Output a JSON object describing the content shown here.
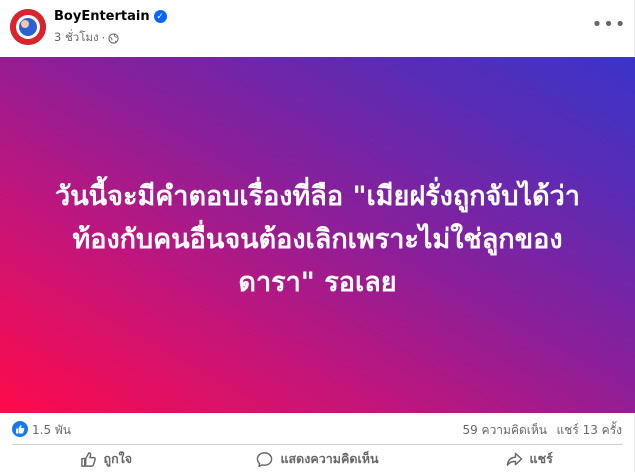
{
  "post": {
    "author": "BoyEntertain",
    "time": "3 ชั่วโมง",
    "image_text": "วันนี้จะมีคำตอบเรื่องที่ลือ \"เมียฝรั่งถูกจับได้ว่า\nท้องกับคนอื่นจนต้องเลิกเพราะไม่ใช่ลูกของ\nดารา\" รอเลย"
  },
  "stats": {
    "reactions": "1.5 พัน",
    "comments": "59 ความคิดเห็น",
    "shares": "แชร์ 13 ครั้ง"
  },
  "actions": {
    "like": "ถูกใจ",
    "comment": "แสดงความคิดเห็น",
    "share": "แชร์"
  },
  "colors": {
    "accent": "#1877f2",
    "gradient_start": "#ff0a4a",
    "gradient_end": "#3a34c9"
  }
}
